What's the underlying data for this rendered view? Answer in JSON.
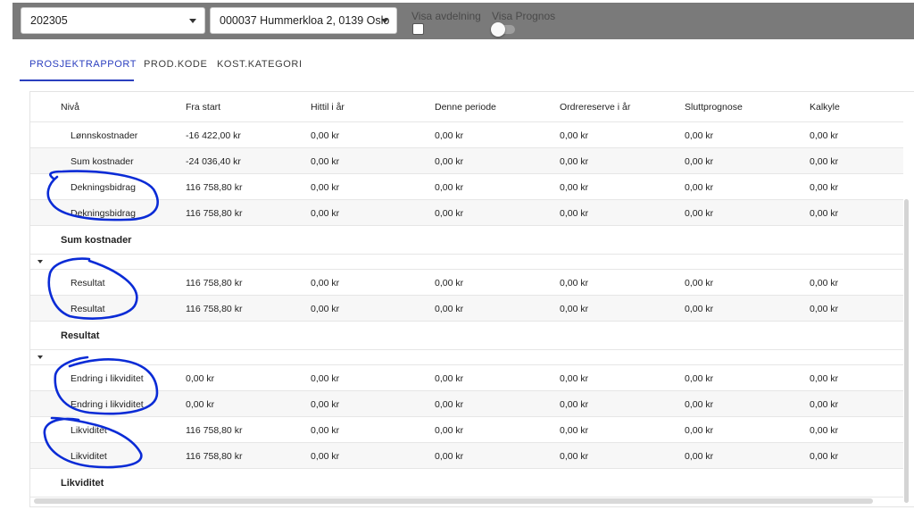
{
  "toolbar": {
    "period_select": "202305",
    "project_select": "000037 Hummerkloa 2, 0139 Oslo",
    "visa_avdelning_label": "Visa avdelning",
    "visa_prognos_label": "Visa Prognos",
    "visa_avdelning_checked": false,
    "visa_prognos_on": false
  },
  "tabs": [
    {
      "label": "PROSJEKTRAPPORT",
      "active": true
    },
    {
      "label": "PROD.KODE",
      "active": false
    },
    {
      "label": "KOST.KATEGORI",
      "active": false
    }
  ],
  "table": {
    "columns": [
      "Nivå",
      "Fra start",
      "Hittil i år",
      "Denne periode",
      "Ordrereserve i år",
      "Sluttprognose",
      "Kalkyle"
    ],
    "rows": [
      {
        "type": "sub",
        "label": "Lønnskostnader",
        "values": [
          "-16 422,00 kr",
          "0,00 kr",
          "0,00 kr",
          "0,00 kr",
          "0,00 kr",
          "0,00 kr"
        ]
      },
      {
        "type": "sub",
        "label": "Sum kostnader",
        "values": [
          "-24 036,40 kr",
          "0,00 kr",
          "0,00 kr",
          "0,00 kr",
          "0,00 kr",
          "0,00 kr"
        ]
      },
      {
        "type": "sub",
        "label": "Dekningsbidrag",
        "values": [
          "116 758,80 kr",
          "0,00 kr",
          "0,00 kr",
          "0,00 kr",
          "0,00 kr",
          "0,00 kr"
        ]
      },
      {
        "type": "sub",
        "label": "Dekningsbidrag",
        "values": [
          "116 758,80 kr",
          "0,00 kr",
          "0,00 kr",
          "0,00 kr",
          "0,00 kr",
          "0,00 kr"
        ]
      },
      {
        "type": "group",
        "label": "Sum kostnader"
      },
      {
        "type": "toggle"
      },
      {
        "type": "sub",
        "label": "Resultat",
        "values": [
          "116 758,80 kr",
          "0,00 kr",
          "0,00 kr",
          "0,00 kr",
          "0,00 kr",
          "0,00 kr"
        ]
      },
      {
        "type": "sub",
        "label": "Resultat",
        "values": [
          "116 758,80 kr",
          "0,00 kr",
          "0,00 kr",
          "0,00 kr",
          "0,00 kr",
          "0,00 kr"
        ]
      },
      {
        "type": "group",
        "label": "Resultat"
      },
      {
        "type": "toggle"
      },
      {
        "type": "sub",
        "label": "Endring i likviditet",
        "values": [
          "0,00 kr",
          "0,00 kr",
          "0,00 kr",
          "0,00 kr",
          "0,00 kr",
          "0,00 kr"
        ]
      },
      {
        "type": "sub",
        "label": "Endring i likviditet",
        "values": [
          "0,00 kr",
          "0,00 kr",
          "0,00 kr",
          "0,00 kr",
          "0,00 kr",
          "0,00 kr"
        ]
      },
      {
        "type": "sub",
        "label": "Likviditet",
        "values": [
          "116 758,80 kr",
          "0,00 kr",
          "0,00 kr",
          "0,00 kr",
          "0,00 kr",
          "0,00 kr"
        ]
      },
      {
        "type": "sub",
        "label": "Likviditet",
        "values": [
          "116 758,80 kr",
          "0,00 kr",
          "0,00 kr",
          "0,00 kr",
          "0,00 kr",
          "0,00 kr"
        ]
      },
      {
        "type": "group",
        "label": "Likviditet"
      }
    ]
  },
  "colors": {
    "accent": "#2b3fbf",
    "toolbar_bg": "#7a7a7a",
    "annotation_ink": "#0a2bd6"
  },
  "icons": [
    "dropdown-caret-icon",
    "collapse-triangle-icon"
  ]
}
